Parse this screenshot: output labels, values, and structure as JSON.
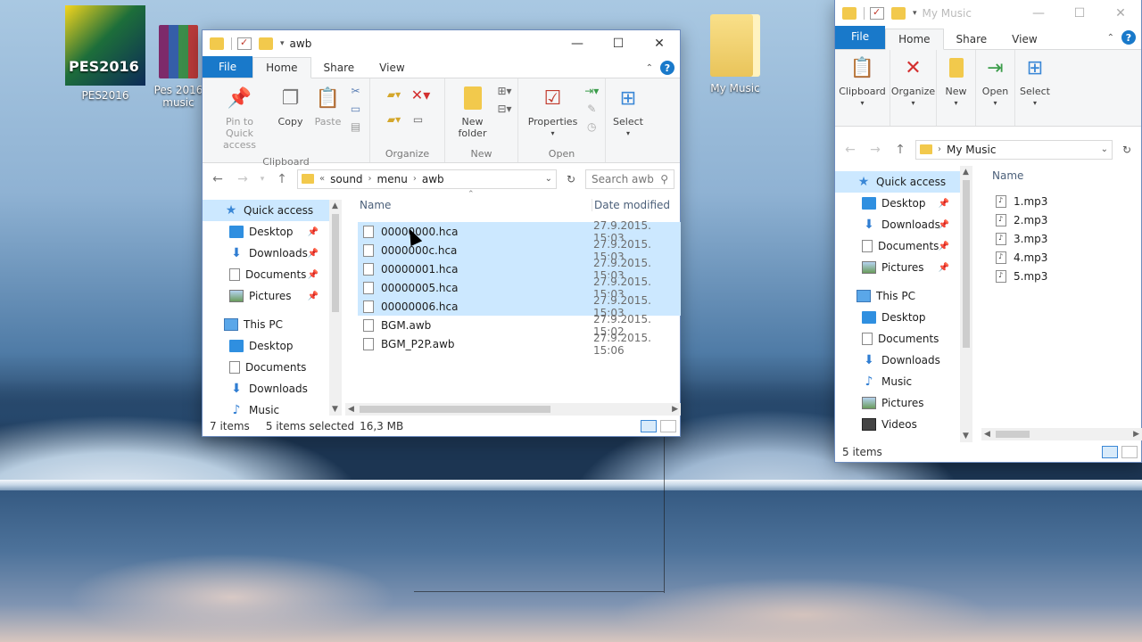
{
  "desktop": {
    "icons": [
      {
        "label": "PES2016"
      },
      {
        "label": "Pes 2016 music"
      },
      {
        "label": "My Music"
      }
    ],
    "pes_logo": "PES2016"
  },
  "win_main": {
    "title": "awb",
    "tabs": {
      "file": "File",
      "home": "Home",
      "share": "Share",
      "view": "View"
    },
    "ribbon": {
      "pin": "Pin to Quick access",
      "copy": "Copy",
      "paste": "Paste",
      "clipboard": "Clipboard",
      "organize": "Organize",
      "new_folder": "New folder",
      "new": "New",
      "properties": "Properties",
      "open": "Open",
      "select": "Select"
    },
    "address": {
      "crumbs": [
        "sound",
        "menu",
        "awb"
      ],
      "prefix": "«"
    },
    "search_placeholder": "Search awb",
    "nav": [
      {
        "label": "Quick access",
        "icon": "star-icon",
        "sel": true
      },
      {
        "label": "Desktop",
        "icon": "desktop-icon",
        "pin": true
      },
      {
        "label": "Downloads",
        "icon": "downloads-icon",
        "pin": true
      },
      {
        "label": "Documents",
        "icon": "documents-icon",
        "pin": true
      },
      {
        "label": "Pictures",
        "icon": "pictures-icon",
        "pin": true
      },
      {
        "label": "This PC",
        "icon": "pc-icon"
      },
      {
        "label": "Desktop",
        "icon": "desktop-icon"
      },
      {
        "label": "Documents",
        "icon": "documents-icon"
      },
      {
        "label": "Downloads",
        "icon": "downloads-icon"
      },
      {
        "label": "Music",
        "icon": "music-icon"
      }
    ],
    "columns": {
      "name": "Name",
      "date": "Date modified"
    },
    "files": [
      {
        "name": "00000000.hca",
        "date": "27.9.2015. 15:03",
        "sel": true
      },
      {
        "name": "0000000c.hca",
        "date": "27.9.2015. 15:03",
        "sel": true
      },
      {
        "name": "00000001.hca",
        "date": "27.9.2015. 15:03",
        "sel": true
      },
      {
        "name": "00000005.hca",
        "date": "27.9.2015. 15:03",
        "sel": true
      },
      {
        "name": "00000006.hca",
        "date": "27.9.2015. 15:03",
        "sel": true
      },
      {
        "name": "BGM.awb",
        "date": "27.9.2015. 15:02",
        "sel": false
      },
      {
        "name": "BGM_P2P.awb",
        "date": "27.9.2015. 15:06",
        "sel": false
      }
    ],
    "status": {
      "count": "7 items",
      "selected": "5 items selected",
      "size": "16,3 MB"
    }
  },
  "win_music": {
    "title": "My Music",
    "tabs": {
      "file": "File",
      "home": "Home",
      "share": "Share",
      "view": "View"
    },
    "ribbon": {
      "clipboard": "Clipboard",
      "organize": "Organize",
      "new": "New",
      "open": "Open",
      "select": "Select"
    },
    "address": {
      "crumbs": [
        "My Music"
      ]
    },
    "nav": [
      {
        "label": "Quick access",
        "icon": "star-icon",
        "sel": true
      },
      {
        "label": "Desktop",
        "icon": "desktop-icon",
        "pin": true
      },
      {
        "label": "Downloads",
        "icon": "downloads-icon",
        "pin": true
      },
      {
        "label": "Documents",
        "icon": "documents-icon",
        "pin": true
      },
      {
        "label": "Pictures",
        "icon": "pictures-icon",
        "pin": true
      },
      {
        "label": "This PC",
        "icon": "pc-icon"
      },
      {
        "label": "Desktop",
        "icon": "desktop-icon"
      },
      {
        "label": "Documents",
        "icon": "documents-icon"
      },
      {
        "label": "Downloads",
        "icon": "downloads-icon"
      },
      {
        "label": "Music",
        "icon": "music-icon"
      },
      {
        "label": "Pictures",
        "icon": "pictures-icon"
      },
      {
        "label": "Videos",
        "icon": "videos-icon"
      }
    ],
    "columns": {
      "name": "Name"
    },
    "files": [
      {
        "name": "1.mp3"
      },
      {
        "name": "2.mp3"
      },
      {
        "name": "3.mp3"
      },
      {
        "name": "4.mp3"
      },
      {
        "name": "5.mp3"
      }
    ],
    "status": {
      "count": "5 items"
    }
  },
  "colors": {
    "accent": "#1979ca",
    "selection": "#cce8ff",
    "folder": "#f2c94c"
  }
}
